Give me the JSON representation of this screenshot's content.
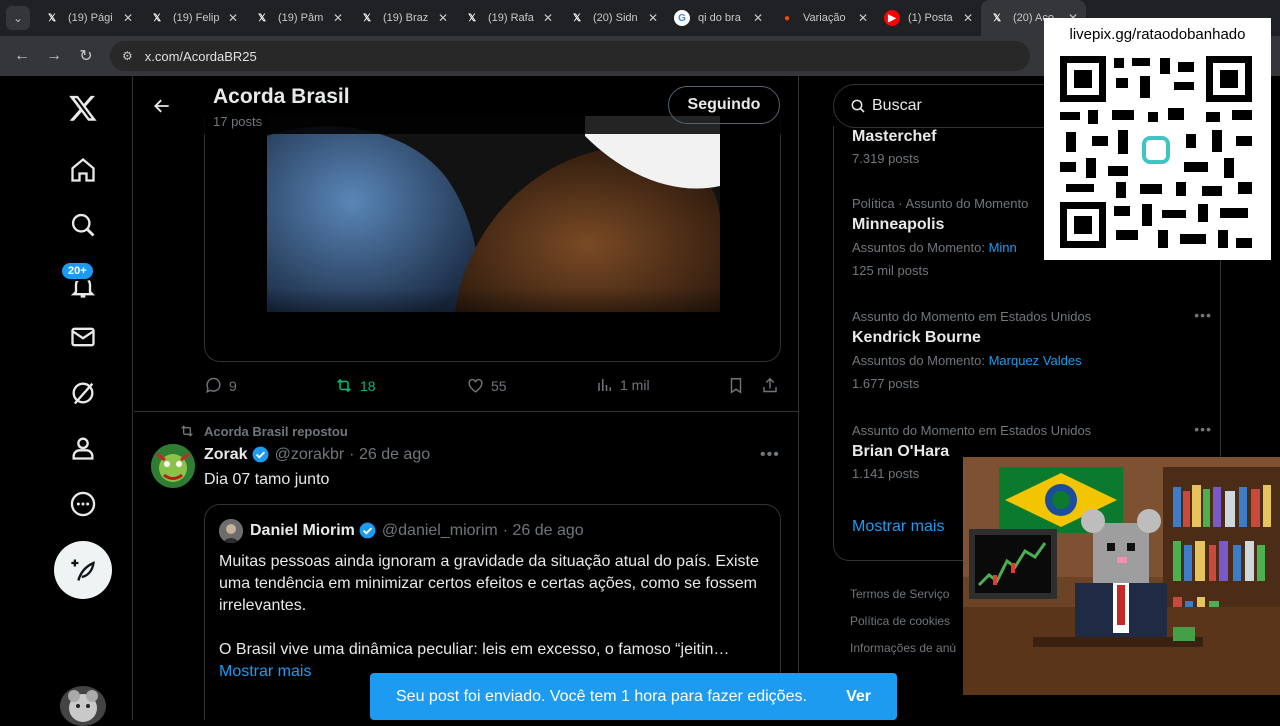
{
  "browser": {
    "tabs": [
      {
        "label": "(19) Pági",
        "icon": "x-logo-icon"
      },
      {
        "label": "(19) Felip",
        "icon": "x-logo-icon"
      },
      {
        "label": "(19) Pâm",
        "icon": "x-logo-icon"
      },
      {
        "label": "(19) Braz",
        "icon": "x-logo-icon"
      },
      {
        "label": "(19) Rafa",
        "icon": "x-logo-icon"
      },
      {
        "label": "(20) Sidn",
        "icon": "x-logo-icon"
      },
      {
        "label": "qi do bra",
        "icon": "google-icon"
      },
      {
        "label": "Variação",
        "icon": "reddit-icon"
      },
      {
        "label": "(1) Posta",
        "icon": "youtube-icon"
      },
      {
        "label": "(20) Aco",
        "icon": "x-logo-icon"
      }
    ],
    "url": "x.com/AcordaBR25"
  },
  "header": {
    "name": "Acorda Brasil",
    "count": "17 posts",
    "follow_label": "Seguindo"
  },
  "post1": {
    "replies": "9",
    "reposts": "18",
    "likes": "55",
    "views": "1 mil"
  },
  "post2": {
    "repost_label": "Acorda Brasil repostou",
    "author": "Zorak",
    "handle": "@zorakbr",
    "date": "· 26 de ago",
    "text": "Dia 07 tamo junto",
    "quote": {
      "author": "Daniel Miorim",
      "handle": "@daniel_miorim",
      "date": "· 26 de ago",
      "line1": "Muitas pessoas ainda ignoram a gravidade da situação atual do país. Existe uma tendência em minimizar certos efeitos e certas ações, como se fossem irrelevantes.",
      "line2": "O Brasil vive uma dinâmica peculiar: leis em excesso, o famoso “jeitin…",
      "more": "Mostrar mais"
    }
  },
  "sidebar": {
    "search_placeholder": "Buscar",
    "trends": [
      {
        "category": "",
        "name": "Masterchef",
        "sub_label": "",
        "sub_link": "",
        "count": "7.319 posts"
      },
      {
        "category": "Política · Assunto do Momento",
        "name": "Minneapolis",
        "sub_label": "Assuntos do Momento:",
        "sub_link": "Minn",
        "count": "125 mil posts"
      },
      {
        "category": "Assunto do Momento em Estados Unidos",
        "name": "Kendrick Bourne",
        "sub_label": "Assuntos do Momento:",
        "sub_link": "Marquez Valdes",
        "count": "1.677 posts"
      },
      {
        "category": "Assunto do Momento em Estados Unidos",
        "name": "Brian O'Hara",
        "sub_label": "",
        "sub_link": "",
        "count": "1.141 posts"
      }
    ],
    "show_more": "Mostrar mais",
    "footer": [
      "Termos de Serviço",
      "Política de cookies",
      "Informações de anú"
    ]
  },
  "overlay": {
    "qr_label": "livepix.gg/rataodobanhado"
  },
  "toast": {
    "message": "Seu post foi enviado. Você tem 1 hora para fazer edições.",
    "action": "Ver"
  },
  "nav": {
    "notifications_badge": "20+"
  },
  "colors": {
    "accent": "#1d9bf0",
    "repost_green": "#00ba7c",
    "background": "#000000",
    "border": "#2f3336"
  }
}
